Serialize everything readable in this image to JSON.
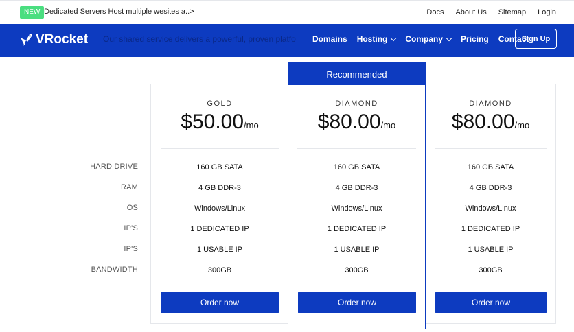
{
  "topbar": {
    "badge": "NEW",
    "announcement": "Dedicated Servers Host multiple wesites a..>",
    "links": [
      "Docs",
      "About Us",
      "Sitemap",
      "Login"
    ]
  },
  "nav": {
    "logo_text": "VRocket",
    "ghost_text": "Our shared service delivers a powerful, proven platfo",
    "menu": [
      "Domains",
      "Hosting",
      "Company",
      "Pricing",
      "Contact"
    ],
    "signup_label": "Sign Up"
  },
  "pricing": {
    "feature_labels": [
      "HARD DRIVE",
      "RAM",
      "OS",
      "IP'S",
      "IP'S",
      "BANDWIDTH"
    ],
    "recommended_label": "Recommended",
    "plans": [
      {
        "name": "GOLD",
        "price": "$50.00",
        "period": "/mo",
        "features": [
          "160 GB SATA",
          "4 GB DDR-3",
          "Windows/Linux",
          "1 DEDICATED IP",
          "1 USABLE IP",
          "300GB"
        ],
        "cta": "Order now"
      },
      {
        "name": "DIAMOND",
        "price": "$80.00",
        "period": "/mo",
        "features": [
          "160 GB SATA",
          "4 GB DDR-3",
          "Windows/Linux",
          "1 DEDICATED IP",
          "1 USABLE IP",
          "300GB"
        ],
        "cta": "Order now"
      },
      {
        "name": "DIAMOND",
        "price": "$80.00",
        "period": "/mo",
        "features": [
          "160 GB SATA",
          "4 GB DDR-3",
          "Windows/Linux",
          "1 DEDICATED IP",
          "1 USABLE IP",
          "300GB"
        ],
        "cta": "Order now"
      }
    ]
  },
  "colors": {
    "brand": "#0d3bc0",
    "badge": "#4ade80"
  }
}
